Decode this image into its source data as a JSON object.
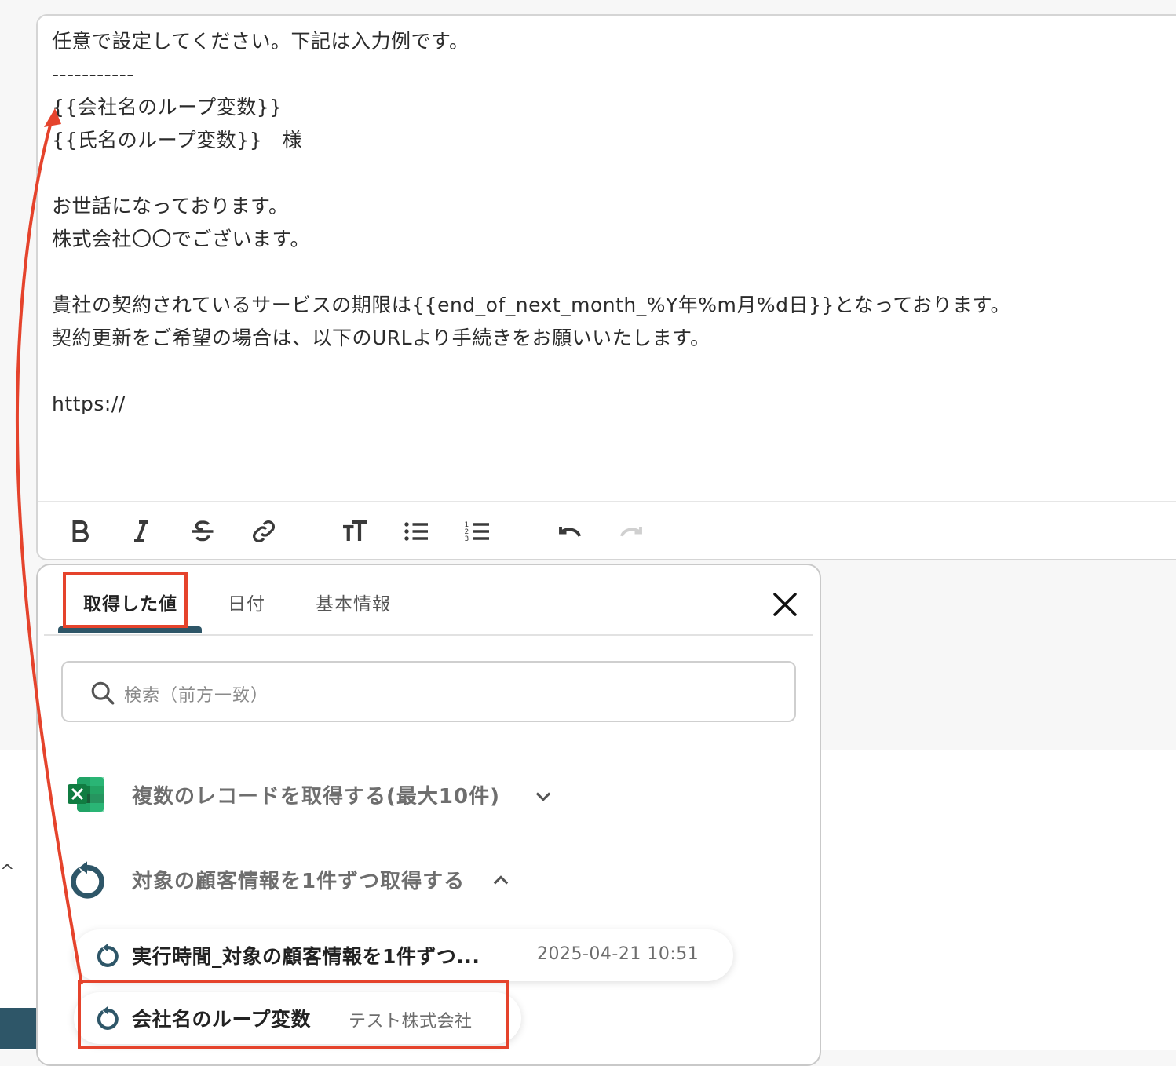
{
  "editor": {
    "lines": [
      "任意で設定してください。下記は入力例です。",
      "-----------",
      "{{会社名のループ変数}}",
      "{{氏名のループ変数}}　様",
      "",
      "お世話になっております。",
      "株式会社〇〇でございます。",
      "",
      "貴社の契約されているサービスの期限は{{end_of_next_month_%Y年%m月%d日}}となっております。",
      "契約更新をご希望の場合は、以下のURLより手続きをお願いいたします。",
      "",
      "https://"
    ],
    "toolbar": {
      "icons": [
        "bold-icon",
        "italic-icon",
        "strikethrough-icon",
        "link-icon",
        "text-size-icon",
        "bullet-list-icon",
        "numbered-list-icon",
        "undo-icon",
        "redo-icon"
      ]
    }
  },
  "panel": {
    "tabs": [
      {
        "label": "取得した値",
        "active": true
      },
      {
        "label": "日付",
        "active": false
      },
      {
        "label": "基本情報",
        "active": false
      }
    ],
    "search": {
      "placeholder": "検索（前方一致）"
    },
    "groups": [
      {
        "label": "複数のレコードを取得する(最大10件)",
        "icon": "excel-icon",
        "expanded": false
      },
      {
        "label": "対象の顧客情報を1件ずつ取得する",
        "icon": "loop-icon",
        "expanded": true
      }
    ],
    "items": [
      {
        "name": "実行時間_対象の顧客情報を1件ずつ...",
        "value": "2025-04-21 10:51"
      },
      {
        "name": "会社名のループ変数",
        "value": "テスト株式会社"
      }
    ]
  },
  "colors": {
    "accent": "#2e5668",
    "highlight": "#e5432c",
    "excel_green": "#1e7145"
  }
}
